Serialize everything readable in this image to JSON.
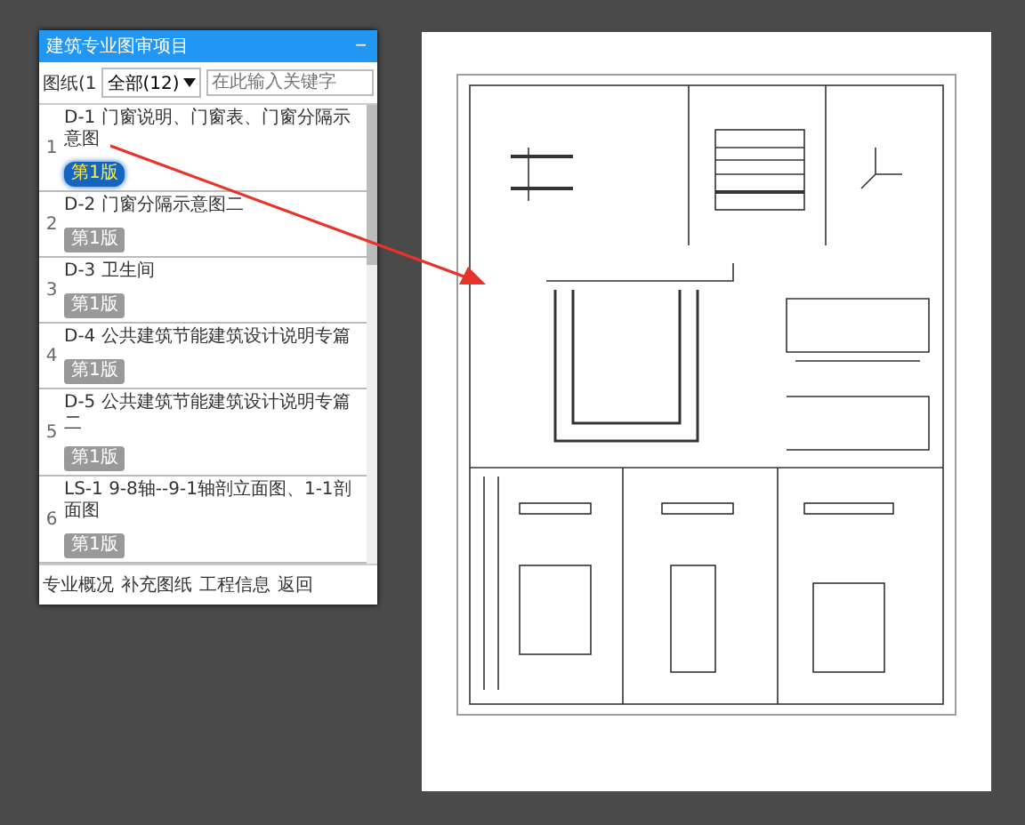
{
  "panel": {
    "title": "建筑专业图审项目",
    "collapse_icon": "−"
  },
  "filter": {
    "label": "图纸(1",
    "select": "全部(12)",
    "search": {
      "placeholder": "在此输入关键字"
    }
  },
  "drawings": [
    {
      "index": "1",
      "title": "D-1 门窗说明、门窗表、门窗分隔示意图",
      "version": "第1版",
      "selected": true
    },
    {
      "index": "2",
      "title": "D-2 门窗分隔示意图二",
      "version": "第1版",
      "selected": false
    },
    {
      "index": "3",
      "title": "D-3 卫生间",
      "version": "第1版",
      "selected": false
    },
    {
      "index": "4",
      "title": "D-4 公共建筑节能建筑设计说明专篇",
      "version": "第1版",
      "selected": false
    },
    {
      "index": "5",
      "title": "D-5 公共建筑节能建筑设计说明专篇二",
      "version": "第1版",
      "selected": false
    },
    {
      "index": "6",
      "title": "LS-1 9-8轴--9-1轴剖立面图、1-1剖面图",
      "version": "第1版",
      "selected": false
    }
  ],
  "footer_links": [
    "专业概况",
    "补充图纸",
    "工程信息",
    "返回"
  ]
}
